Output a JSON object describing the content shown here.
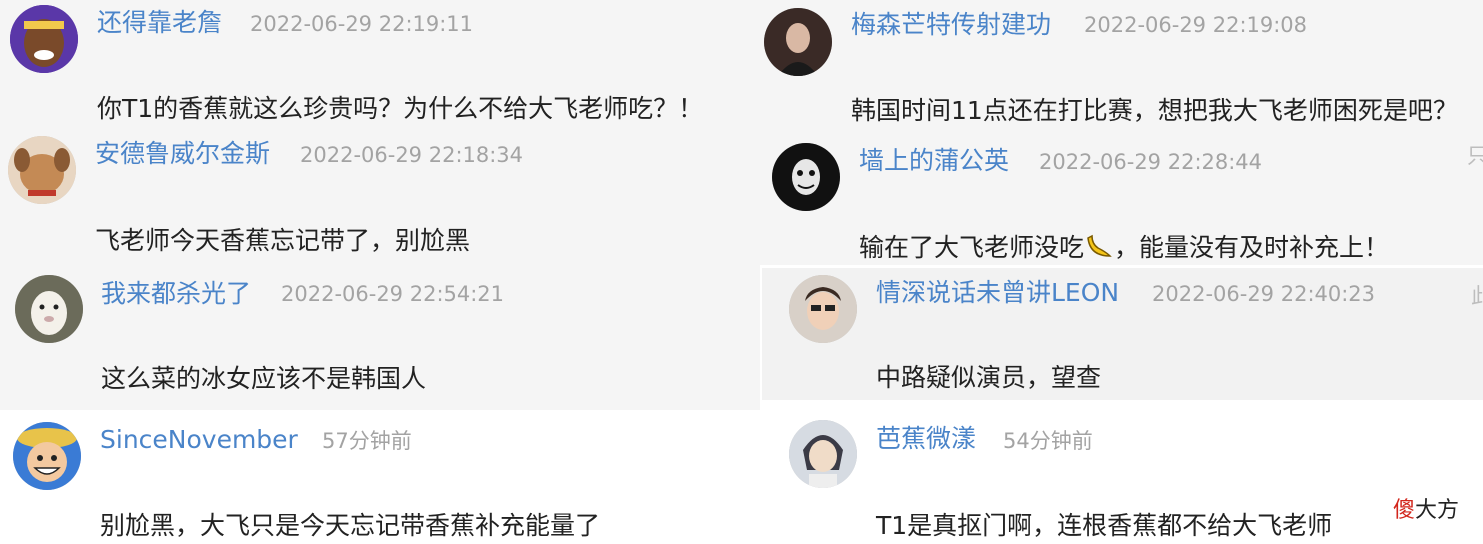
{
  "comments": [
    {
      "user": "还得靠老詹",
      "time": "2022-06-29 22:19:11",
      "text": "你T1的香蕉就这么珍贵吗？为什么不给大飞老师吃？！"
    },
    {
      "user": "梅森芒特传射建功",
      "time": "2022-06-29 22:19:08",
      "text": "韩国时间11点还在打比赛，想把我大飞老师困死是吧？"
    },
    {
      "user": "安德鲁威尔金斯",
      "time": "2022-06-29 22:18:34",
      "text": "飞老师今天香蕉忘记带了，别尬黑"
    },
    {
      "user": "墙上的蒲公英",
      "time": "2022-06-29 22:28:44",
      "text": "输在了大飞老师没吃",
      "text2": "，能量没有及时补充上！",
      "emoji": "banana-emoji"
    },
    {
      "user": "我来都杀光了",
      "time": "2022-06-29 22:54:21",
      "text": "这么菜的冰女应该不是韩国人"
    },
    {
      "user": "情深说话未曾讲LEON",
      "time": "2022-06-29 22:40:23",
      "text": "中路疑似演员，望查"
    },
    {
      "user": "SinceNovember",
      "time": "57分钟前",
      "text": "别尬黑，大飞只是今天忘记带香蕉补充能量了"
    },
    {
      "user": "芭蕉微漾",
      "time": "54分钟前",
      "text": "T1是真抠门啊，连根香蕉都不给大飞老师"
    }
  ],
  "edge_glyphs": {
    "row2": "只",
    "row3": "此"
  },
  "watermark": {
    "red": "傻",
    "rest": "大方"
  },
  "colors": {
    "username": "#4a84c9",
    "timestamp": "#a3a3a3",
    "text": "#222222",
    "hover_bg": "#f5f5f5",
    "watermark_red": "#d2261c"
  }
}
